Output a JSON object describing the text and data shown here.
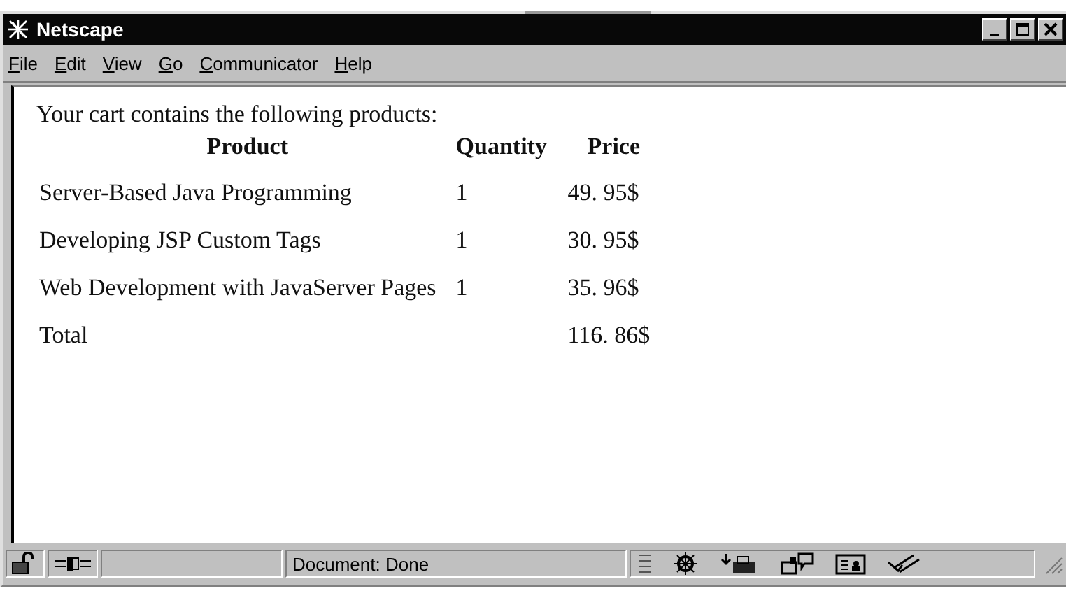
{
  "window": {
    "title": "Netscape"
  },
  "menu": [
    "File",
    "Edit",
    "View",
    "Go",
    "Communicator",
    "Help"
  ],
  "intro": "Your cart contains the following products:",
  "table": {
    "columns": [
      "Product",
      "Quantity",
      "Price"
    ],
    "rows": [
      {
        "product": "Server-Based Java Programming",
        "quantity": "1",
        "price": "49. 95$"
      },
      {
        "product": "Developing JSP Custom Tags",
        "quantity": "1",
        "price": "30. 95$"
      },
      {
        "product": "Web Development with JavaServer Pages",
        "quantity": "1",
        "price": "35. 96$"
      }
    ],
    "total": {
      "label": "Total",
      "price": "116. 86$"
    }
  },
  "status_bar": {
    "text": "Document: Done"
  }
}
